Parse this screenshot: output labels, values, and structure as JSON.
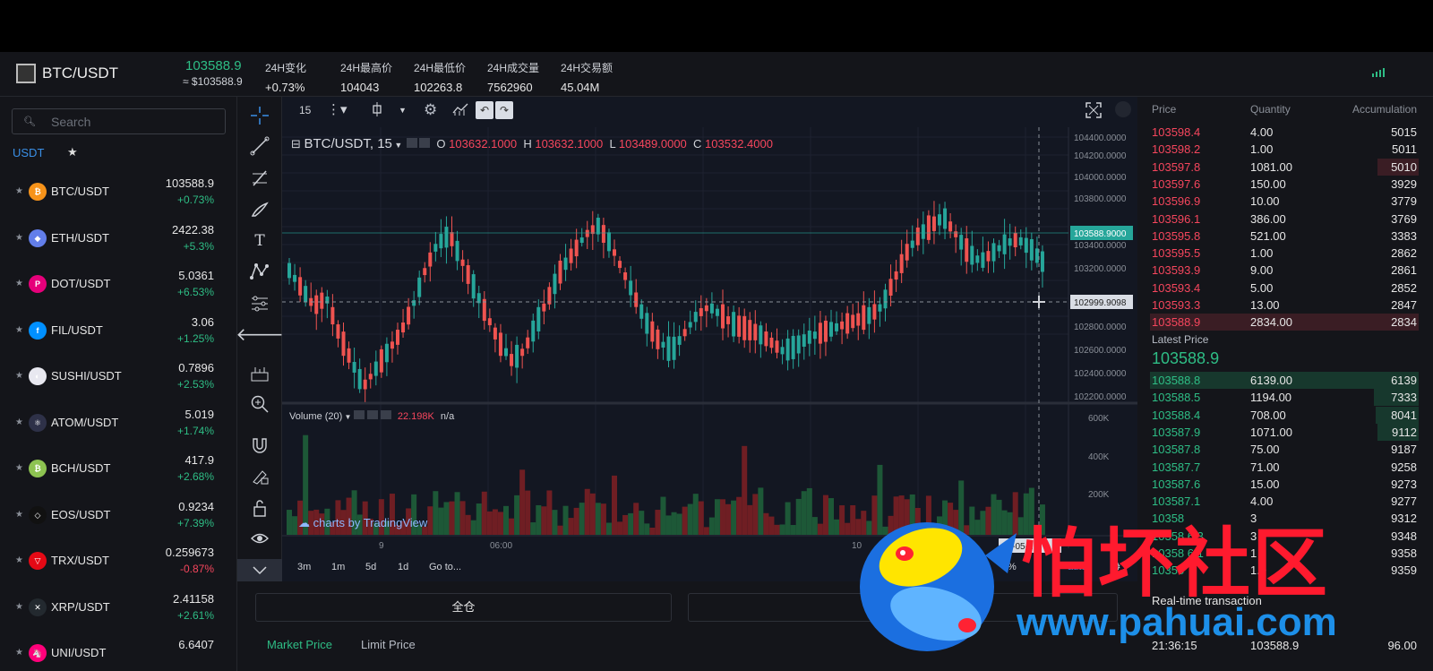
{
  "header": {
    "pair": "BTC/USDT",
    "price": "103588.9",
    "usd_price": "≈ $103588.9",
    "stats": [
      {
        "label": "24H变化",
        "value": "+0.73%"
      },
      {
        "label": "24H最高价",
        "value": "104043"
      },
      {
        "label": "24H最低价",
        "value": "102263.8"
      },
      {
        "label": "24H成交量",
        "value": "7562960"
      },
      {
        "label": "24H交易额",
        "value": "45.04M"
      }
    ]
  },
  "sidebar": {
    "search_placeholder": "Search",
    "tab_usdt": "USDT",
    "tab_fav": "★",
    "coins": [
      {
        "name": "BTC/USDT",
        "price": "103588.9",
        "change": "+0.73%",
        "dir": "up",
        "color": "#f7931a",
        "glyph": "₿"
      },
      {
        "name": "ETH/USDT",
        "price": "2422.38",
        "change": "+5.3%",
        "dir": "up",
        "color": "#627eea",
        "glyph": "◆"
      },
      {
        "name": "DOT/USDT",
        "price": "5.0361",
        "change": "+6.53%",
        "dir": "up",
        "color": "#e6007a",
        "glyph": "P"
      },
      {
        "name": "FIL/USDT",
        "price": "3.06",
        "change": "+1.25%",
        "dir": "up",
        "color": "#0090ff",
        "glyph": "f"
      },
      {
        "name": "SUSHI/USDT",
        "price": "0.7896",
        "change": "+2.53%",
        "dir": "up",
        "color": "#e8e8f0",
        "glyph": "◐"
      },
      {
        "name": "ATOM/USDT",
        "price": "5.019",
        "change": "+1.74%",
        "dir": "up",
        "color": "#2e3148",
        "glyph": "⚛"
      },
      {
        "name": "BCH/USDT",
        "price": "417.9",
        "change": "+2.68%",
        "dir": "up",
        "color": "#8dc351",
        "glyph": "₿"
      },
      {
        "name": "EOS/USDT",
        "price": "0.9234",
        "change": "+7.39%",
        "dir": "up",
        "color": "#111111",
        "glyph": "◇"
      },
      {
        "name": "TRX/USDT",
        "price": "0.259673",
        "change": "-0.87%",
        "dir": "down",
        "color": "#e50915",
        "glyph": "▽"
      },
      {
        "name": "XRP/USDT",
        "price": "2.41158",
        "change": "+2.61%",
        "dir": "up",
        "color": "#23292f",
        "glyph": "✕"
      },
      {
        "name": "UNI/USDT",
        "price": "6.6407",
        "change": "",
        "dir": "up",
        "color": "#ff007a",
        "glyph": "🦄"
      }
    ]
  },
  "chart": {
    "interval": "15",
    "symbol": "BTC/USDT, 15",
    "ohlc": {
      "o_label": "O",
      "o": "103632.1000",
      "h_label": "H",
      "h": "103632.1000",
      "l_label": "L",
      "l": "103489.0000",
      "c_label": "C",
      "c": "103532.4000"
    },
    "price_ticks": [
      "104400.0000",
      "104200.0000",
      "104000.0000",
      "103800.0000",
      "103588.9000",
      "103400.0000",
      "103200.0000",
      "102999.9098",
      "102800.0000",
      "102600.0000",
      "102400.0000",
      "102200.0000"
    ],
    "volume_legend": "Volume (20)",
    "volume_value": "22.198K",
    "volume_na": "n/a",
    "volume_ticks": [
      "600K",
      "400K",
      "200K"
    ],
    "time_ticks": [
      "9",
      "06:00",
      "10"
    ],
    "crosshair_time": "25-05-1",
    "tv_credit": "charts by TradingView",
    "intervals": [
      "3m",
      "1m",
      "5d",
      "1d",
      "Go to..."
    ],
    "bottom_right": [
      "%",
      "auto"
    ],
    "utc": "UTC"
  },
  "trade": {
    "full_label": "全仓",
    "tab_market": "Market Price",
    "tab_limit": "Limit Price"
  },
  "orderbook": {
    "headers": [
      "Price",
      "Quantity",
      "Accumulation"
    ],
    "asks": [
      {
        "price": "103598.4",
        "qty": "4.00",
        "acc": "5015"
      },
      {
        "price": "103598.2",
        "qty": "1.00",
        "acc": "5011"
      },
      {
        "price": "103597.8",
        "qty": "1081.00",
        "acc": "5010"
      },
      {
        "price": "103597.6",
        "qty": "150.00",
        "acc": "3929"
      },
      {
        "price": "103596.9",
        "qty": "10.00",
        "acc": "3779"
      },
      {
        "price": "103596.1",
        "qty": "386.00",
        "acc": "3769"
      },
      {
        "price": "103595.8",
        "qty": "521.00",
        "acc": "3383"
      },
      {
        "price": "103595.5",
        "qty": "1.00",
        "acc": "2862"
      },
      {
        "price": "103593.9",
        "qty": "9.00",
        "acc": "2861"
      },
      {
        "price": "103593.4",
        "qty": "5.00",
        "acc": "2852"
      },
      {
        "price": "103593.3",
        "qty": "13.00",
        "acc": "2847"
      },
      {
        "price": "103588.9",
        "qty": "2834.00",
        "acc": "2834"
      }
    ],
    "latest_label": "Latest Price",
    "latest_price": "103588.9",
    "bids": [
      {
        "price": "103588.8",
        "qty": "6139.00",
        "acc": "6139"
      },
      {
        "price": "103588.5",
        "qty": "1194.00",
        "acc": "7333"
      },
      {
        "price": "103588.4",
        "qty": "708.00",
        "acc": "8041"
      },
      {
        "price": "103587.9",
        "qty": "1071.00",
        "acc": "9112"
      },
      {
        "price": "103587.8",
        "qty": "75.00",
        "acc": "9187"
      },
      {
        "price": "103587.7",
        "qty": "71.00",
        "acc": "9258"
      },
      {
        "price": "103587.6",
        "qty": "15.00",
        "acc": "9273"
      },
      {
        "price": "103587.1",
        "qty": "4.00",
        "acc": "9277"
      },
      {
        "price": "10358",
        "qty": "3",
        "acc": "9312"
      },
      {
        "price": "10358 6.3",
        "qty": "3",
        "acc": "9348"
      },
      {
        "price": "10358 6.1",
        "qty": "1",
        "acc": "9358"
      },
      {
        "price": "10358",
        "qty": "1.0",
        "acc": "9359"
      }
    ],
    "rt_title": "Real-time transaction",
    "rt_row": {
      "time": "21:36:15",
      "price": "103588.9",
      "qty": "96.00"
    }
  },
  "promo": {
    "title_cn": "怕坏社区",
    "url": "www.pahuai.com"
  },
  "colors": {
    "up": "#2ebd85",
    "down": "#f6465d",
    "accent": "#3a8fe6"
  }
}
